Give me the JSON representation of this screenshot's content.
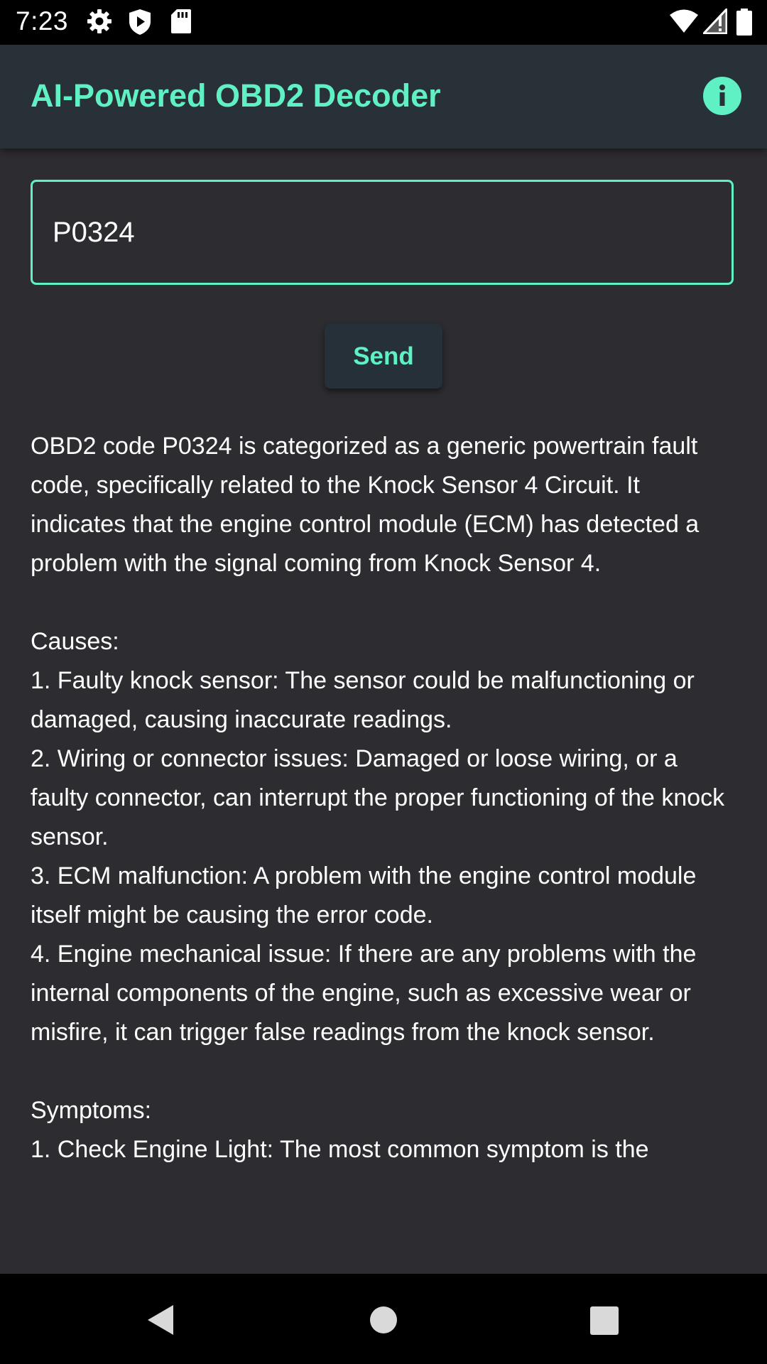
{
  "status_bar": {
    "time": "7:23",
    "left_icons": [
      "settings-icon",
      "play-protect-icon",
      "sd-card-icon"
    ],
    "right_icons": [
      "wifi-icon",
      "signal-icon",
      "battery-icon"
    ]
  },
  "app_bar": {
    "title": "AI-Powered OBD2 Decoder",
    "info_icon": "info-icon"
  },
  "input": {
    "value": "P0324"
  },
  "send_button": {
    "label": "Send"
  },
  "response_text": "OBD2 code P0324 is categorized as a generic powertrain fault code, specifically related to the Knock Sensor 4 Circuit. It indicates that the engine control module (ECM) has detected a problem with the signal coming from Knock Sensor 4.\n\nCauses:\n1. Faulty knock sensor: The sensor could be malfunctioning or damaged, causing inaccurate readings.\n2. Wiring or connector issues: Damaged or loose wiring, or a faulty connector, can interrupt the proper functioning of the knock sensor.\n3. ECM malfunction: A problem with the engine control module itself might be causing the error code.\n4. Engine mechanical issue: If there are any problems with the internal components of the engine, such as excessive wear or misfire, it can trigger false readings from the knock sensor.\n\nSymptoms:\n1. Check Engine Light: The most common symptom is the",
  "nav_bar": {
    "icons": [
      "back-icon",
      "home-icon",
      "recents-icon"
    ]
  },
  "colors": {
    "accent": "#5ff0c4",
    "background": "#2d2c30",
    "app_bar": "#283038",
    "button": "#263038"
  }
}
